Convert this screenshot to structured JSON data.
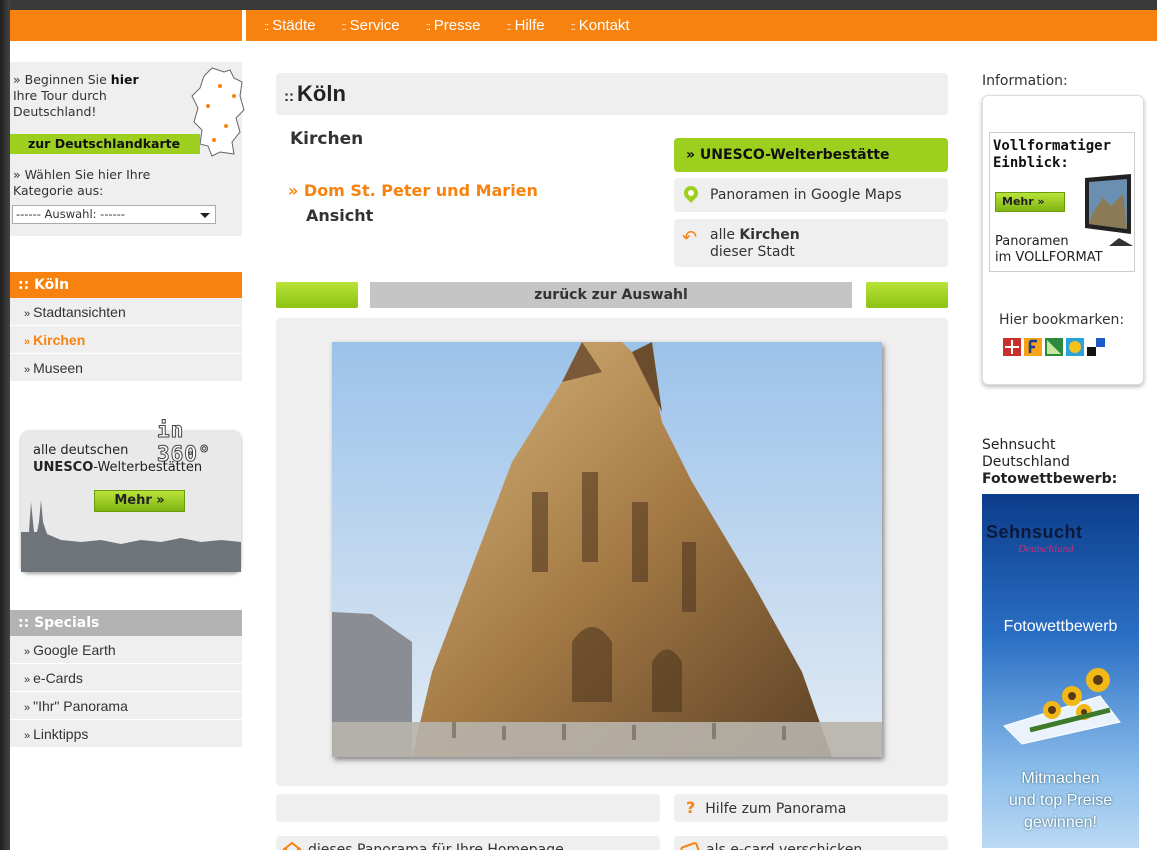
{
  "topnav": [
    "Städte",
    "Service",
    "Presse",
    "Hilfe",
    "Kontakt"
  ],
  "left": {
    "tour_prefix": "» Beginnen Sie ",
    "tour_bold": "hier",
    "tour_rest": "Ihre Tour durch Deutschland!",
    "map_button": "zur Deutschlandkarte",
    "category_text": "» Wählen Sie hier Ihre Kategorie aus:",
    "select_value": "------ Auswahl: ------",
    "city_heading": ":: Köln",
    "city_items": [
      "Stadtansichten",
      "Kirchen",
      "Museen"
    ],
    "active_item": "Kirchen",
    "unesco_badge": "in 360°",
    "unesco_line1": "alle deutschen",
    "unesco_bold": "UNESCO",
    "unesco_rest": "-Welterbestätten",
    "unesco_button": "Mehr »",
    "specials_heading": ":: Specials",
    "specials_items": [
      "Google Earth",
      "e-Cards",
      "\"Ihr\" Panorama",
      "Linktipps"
    ]
  },
  "center": {
    "title": "Köln",
    "subtitle": "Kirchen",
    "dom_link": "» Dom St. Peter und Marien",
    "ansicht": "Ansicht",
    "unesco_button": "» UNESCO-Welterbestätte",
    "maps_button": "Panoramen in Google Maps",
    "alle_prefix": "alle ",
    "alle_bold": "Kirchen",
    "alle_rest": "dieser Stadt",
    "back_label": "zurück zur Auswahl",
    "help_label": "Hilfe zum Panorama",
    "homepage_label": "dieses Panorama für Ihre Homepage",
    "ecard_label": "als e-card verschicken"
  },
  "right": {
    "info_label": "Information:",
    "voll_title": "Vollformatiger Einblick:",
    "mehr_label": "Mehr »",
    "voll_sub1": "Panoramen",
    "voll_sub2": "im VOLLFORMAT",
    "bookmark_label": "Hier bookmarken:",
    "sehn_line1": "Sehnsucht",
    "sehn_line2": "Deutschland",
    "sehn_bold": "Fotowettbewerb:",
    "banner_title": "Sehnsucht",
    "banner_sub": "Deutschland",
    "banner_foto": "Fotowettbewerb",
    "banner_bottom": [
      "Mitmachen",
      "und top Preise",
      "gewinnen!"
    ]
  },
  "colors": {
    "orange": "#f7820f",
    "green": "#9ccf1e",
    "gray_panel": "#efefef"
  }
}
